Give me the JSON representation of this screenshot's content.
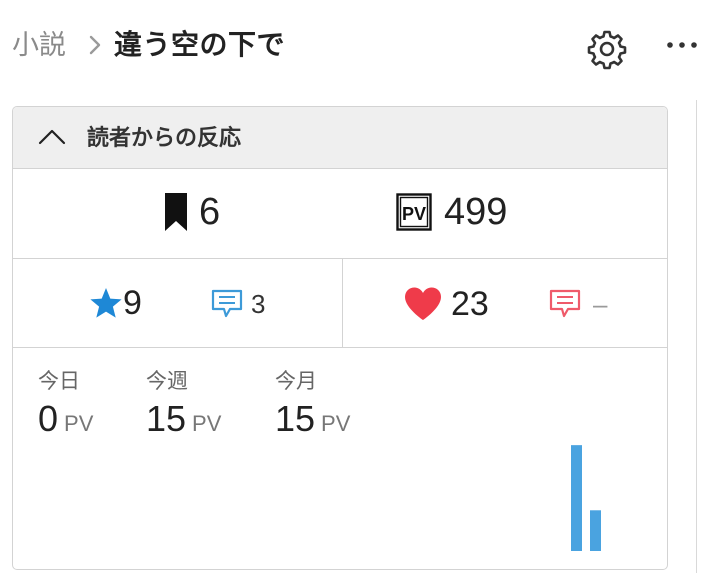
{
  "header": {
    "breadcrumb_parent": "小説",
    "title": "違う空の下で"
  },
  "card": {
    "header_title": "読者からの反応",
    "bookmarks": "6",
    "pv_total": "499",
    "stars": "9",
    "star_comments": "3",
    "hearts": "23",
    "heart_comments": "–",
    "colors": {
      "star": "#1e88d6",
      "heart": "#ef3b4a",
      "comment_blue": "#3d9ad8",
      "comment_red": "#ef5a6a",
      "bar": "#4aa3e0"
    }
  },
  "pv": {
    "today_label": "今日",
    "today_value": "0",
    "week_label": "今週",
    "week_value": "15",
    "month_label": "今月",
    "month_value": "15",
    "unit": "PV"
  },
  "chart_data": {
    "type": "bar",
    "values": [
      13,
      5
    ],
    "ylim": [
      0,
      14
    ]
  }
}
